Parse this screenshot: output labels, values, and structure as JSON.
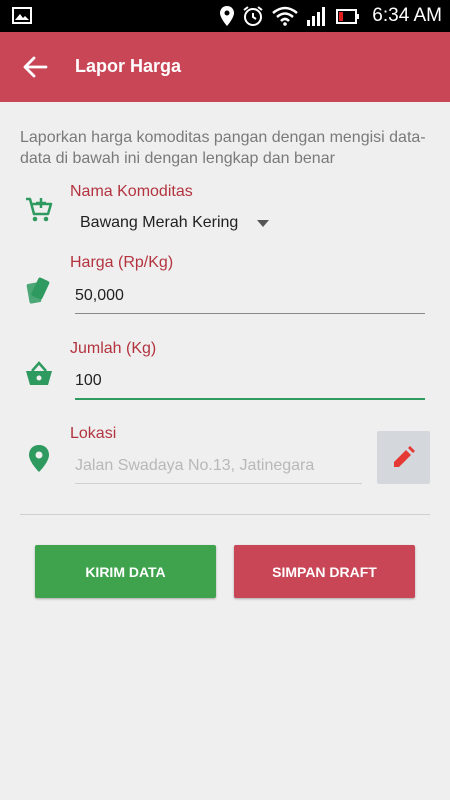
{
  "status_bar": {
    "time": "6:34 AM"
  },
  "app_bar": {
    "title": "Lapor Harga"
  },
  "intro": "Laporkan harga komoditas pangan dengan mengisi data-data di bawah ini dengan lengkap dan benar",
  "form": {
    "commodity": {
      "label": "Nama Komoditas",
      "value": "Bawang Merah Kering"
    },
    "price": {
      "label": "Harga (Rp/Kg)",
      "value": "50,000"
    },
    "quantity": {
      "label": "Jumlah (Kg)",
      "value": "100"
    },
    "location": {
      "label": "Lokasi",
      "value": "Jalan Swadaya No.13, Jatinegara"
    }
  },
  "buttons": {
    "send": "KIRIM DATA",
    "draft": "SIMPAN DRAFT"
  },
  "colors": {
    "primary": "#c94656",
    "accent_green": "#3fa34d",
    "icon_green": "#2e9a5f",
    "label_red": "#b3343f"
  },
  "icons": [
    "gallery-icon",
    "location-icon",
    "alarm-icon",
    "wifi-icon",
    "signal-icon",
    "battery-icon",
    "back-arrow-icon",
    "cart-add-icon",
    "price-tag-icon",
    "basket-icon",
    "map-pin-icon",
    "pencil-icon"
  ]
}
